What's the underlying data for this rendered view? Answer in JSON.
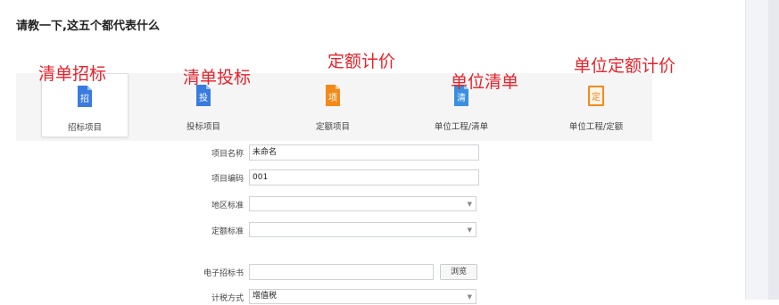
{
  "question": "请教一下,这五个都代表什么",
  "annotations": [
    "清单招标",
    "清单投标",
    "定额计价",
    "单位清单",
    "单位定额计价"
  ],
  "toolbar": {
    "buttons": [
      {
        "label": "招标项目",
        "icon": "招",
        "icon_name": "tender-doc-icon",
        "color": "#3a7be0"
      },
      {
        "label": "投标项目",
        "icon": "投",
        "icon_name": "bid-doc-icon",
        "color": "#3a7be0"
      },
      {
        "label": "定额项目",
        "icon": "项",
        "icon_name": "quota-project-icon",
        "color": "#f28a1b"
      },
      {
        "label": "单位工程/清单",
        "icon": "清",
        "icon_name": "unit-list-icon",
        "color": "#3a8fe0"
      },
      {
        "label": "单位工程/定额",
        "icon": "定",
        "icon_name": "unit-quota-icon",
        "color": "#f28a1b"
      }
    ]
  },
  "form": {
    "project_name_label": "项目名称",
    "project_name_value": "未命名",
    "project_code_label": "项目编码",
    "project_code_value": "001",
    "region_label": "地区标准",
    "region_value": "",
    "quota_label": "定额标准",
    "quota_value": "",
    "tender_file_label": "电子招标书",
    "tender_file_value": "",
    "browse_label": "浏览",
    "tax_label": "计税方式",
    "tax_value": "增值税"
  },
  "colors": {
    "annotation": "#e8222b",
    "accent_blue": "#3a7be0",
    "accent_orange": "#f28a1b"
  }
}
